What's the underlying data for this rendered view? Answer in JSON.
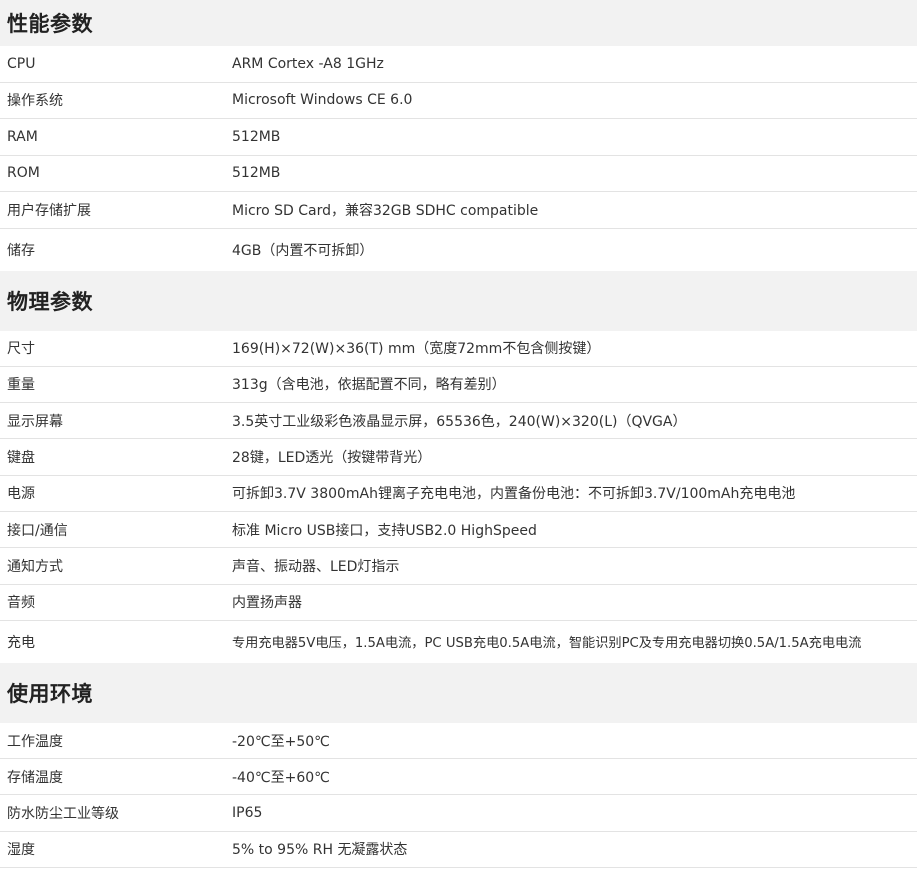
{
  "sections": [
    {
      "title": "性能参数",
      "rows": [
        {
          "key": "CPU",
          "value": "ARM Cortex -A8 1GHz"
        },
        {
          "key": "操作系统",
          "value": "Microsoft Windows CE 6.0"
        },
        {
          "key": "RAM",
          "value": "512MB"
        },
        {
          "key": "ROM",
          "value": "512MB"
        },
        {
          "key": "用户存储扩展",
          "value": "Micro SD Card，兼容32GB SDHC compatible"
        },
        {
          "key": "储存",
          "value": "4GB（内置不可拆卸）"
        }
      ]
    },
    {
      "title": "物理参数",
      "rows": [
        {
          "key": "尺寸",
          "value": "169(H)×72(W)×36(T) mm（宽度72mm不包含侧按键）"
        },
        {
          "key": "重量",
          "value": "313g（含电池，依据配置不同，略有差别）"
        },
        {
          "key": "显示屏幕",
          "value": "3.5英寸工业级彩色液晶显示屏，65536色，240(W)×320(L)（QVGA）"
        },
        {
          "key": "键盘",
          "value": "28键，LED透光（按键带背光）"
        },
        {
          "key": "电源",
          "value": "可拆卸3.7V 3800mAh锂离子充电电池，内置备份电池：不可拆卸3.7V/100mAh充电电池"
        },
        {
          "key": "接口/通信",
          "value": "标准 Micro USB接口，支持USB2.0 HighSpeed"
        },
        {
          "key": "通知方式",
          "value": "声音、振动器、LED灯指示"
        },
        {
          "key": "音频",
          "value": "内置扬声器"
        },
        {
          "key": "充电",
          "value": "专用充电器5V电压，1.5A电流，PC USB充电0.5A电流，智能识别PC及专用充电器切换0.5A/1.5A充电电流"
        }
      ]
    },
    {
      "title": "使用环境",
      "rows": [
        {
          "key": "工作温度",
          "value": "-20℃至+50℃"
        },
        {
          "key": "存储温度",
          "value": "-40℃至+60℃"
        },
        {
          "key": "防水防尘工业等级",
          "value": "IP65"
        },
        {
          "key": "湿度",
          "value": "5% to 95% RH 无凝露状态"
        }
      ]
    }
  ]
}
